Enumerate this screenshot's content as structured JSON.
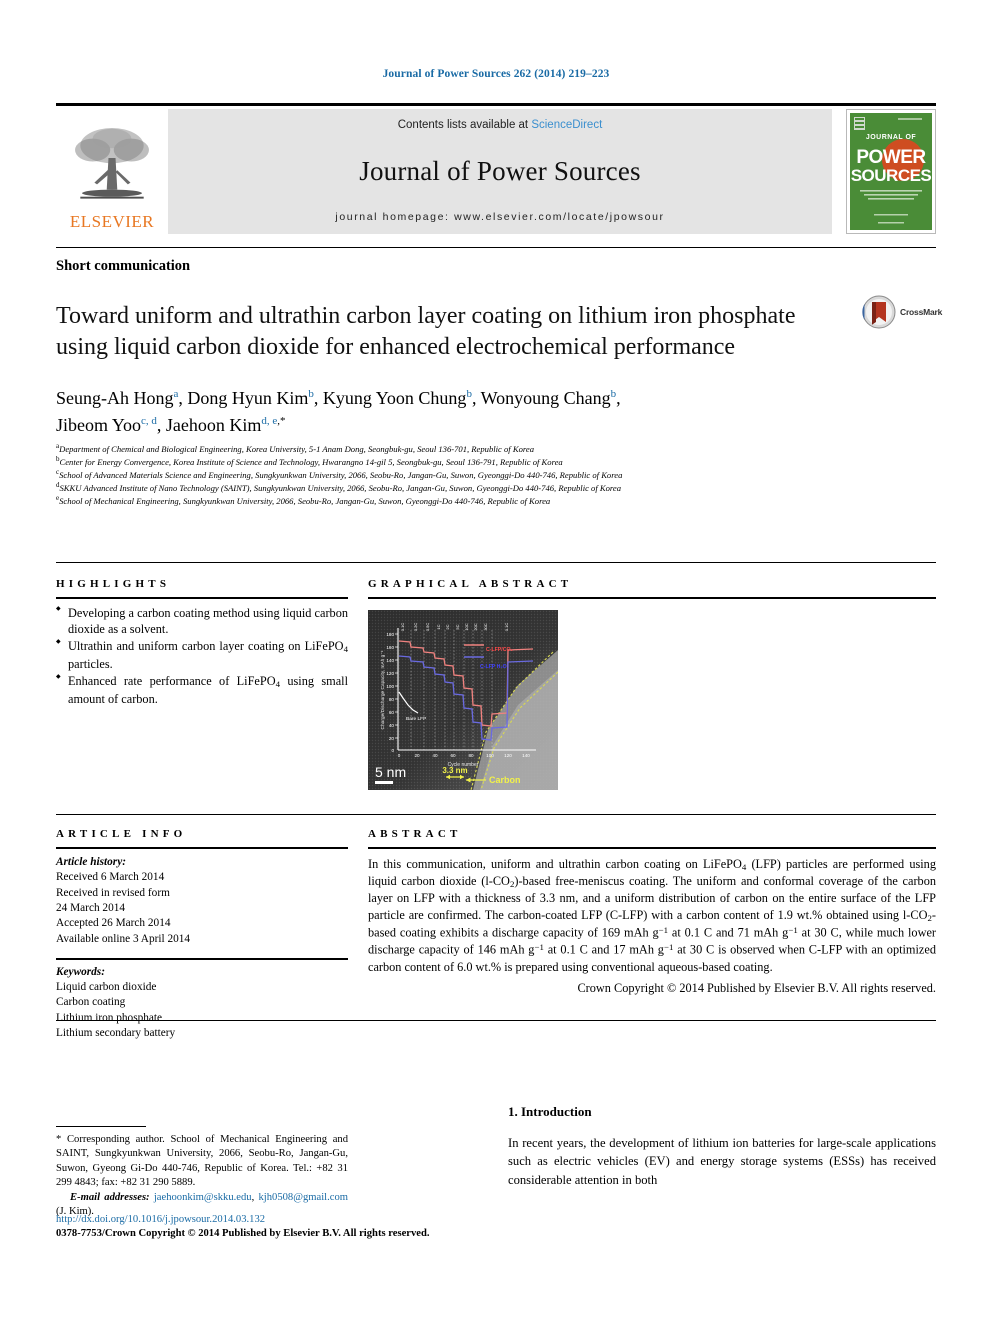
{
  "running_head": "Journal of Power Sources 262 (2014) 219–223",
  "masthead": {
    "publisher": "ELSEVIER",
    "contents_prefix": "Contents lists available at ",
    "sciencedirect": "ScienceDirect",
    "journal_name": "Journal of Power Sources",
    "homepage": "journal homepage: www.elsevier.com/locate/jpowsour",
    "cover_line1": "JOURNAL OF",
    "cover_line2": "POWER",
    "cover_line3": "SOURCES"
  },
  "article_type": "Short communication",
  "title": "Toward uniform and ultrathin carbon layer coating on lithium iron phosphate using liquid carbon dioxide for enhanced electrochemical performance",
  "crossmark_label": "CrossMark",
  "authors": [
    {
      "name": "Seung-Ah Hong",
      "sup": "a"
    },
    {
      "name": "Dong Hyun Kim",
      "sup": "b"
    },
    {
      "name": "Kyung Yoon Chung",
      "sup": "b"
    },
    {
      "name": "Wonyoung Chang",
      "sup": "b"
    },
    {
      "name": "Jibeom Yoo",
      "sup": "c, d"
    },
    {
      "name": "Jaehoon Kim",
      "sup": "d, e",
      "corresponding": true
    }
  ],
  "affiliations": [
    {
      "mark": "a",
      "text": "Department of Chemical and Biological Engineering, Korea University, 5-1 Anam Dong, Seongbuk-gu, Seoul 136-701, Republic of Korea"
    },
    {
      "mark": "b",
      "text": "Center for Energy Convergence, Korea Institute of Science and Technology, Hwarangno 14-gil 5, Seongbuk-gu, Seoul 136-791, Republic of Korea"
    },
    {
      "mark": "c",
      "text": "School of Advanced Materials Science and Engineering, Sungkyunkwan University, 2066, Seobu-Ro, Jangan-Gu, Suwon, Gyeonggi-Do 440-746, Republic of Korea"
    },
    {
      "mark": "d",
      "text": "SKKU Advanced Institute of Nano Technology (SAINT), Sungkyunkwan University, 2066, Seobu-Ro, Jangan-Gu, Suwon, Gyeonggi-Do 440-746, Republic of Korea"
    },
    {
      "mark": "e",
      "text": "School of Mechanical Engineering, Sungkyunkwan University, 2066, Seobu-Ro, Jangan-Gu, Suwon, Gyeonggi-Do 440-746, Republic of Korea"
    }
  ],
  "highlights": {
    "heading": "HIGHLIGHTS",
    "items": [
      "Developing a carbon coating method using liquid carbon dioxide as a solvent.",
      "Ultrathin and uniform carbon layer coating on LiFePO4 particles.",
      "Enhanced rate performance of LiFePO4 using small amount of carbon."
    ]
  },
  "graphical_abstract": {
    "heading": "GRAPHICAL ABSTRACT",
    "scale_bar": "5 nm",
    "thickness_label": "3.3 nm",
    "carbon_label": "Carbon"
  },
  "article_info": {
    "heading": "ARTICLE INFO",
    "history_label": "Article history:",
    "history": [
      "Received 6 March 2014",
      "Received in revised form",
      "24 March 2014",
      "Accepted 26 March 2014",
      "Available online 3 April 2014"
    ],
    "keywords_label": "Keywords:",
    "keywords": [
      "Liquid carbon dioxide",
      "Carbon coating",
      "Lithium iron phosphate",
      "Lithium secondary battery"
    ]
  },
  "abstract": {
    "heading": "ABSTRACT",
    "text_parts": [
      "In this communication, uniform and ultrathin carbon coating on LiFePO",
      "4",
      " (LFP) particles are performed using liquid carbon dioxide (l-CO",
      "2",
      ")-based free-meniscus coating. The uniform and conformal coverage of the carbon layer on LFP with a thickness of 3.3 nm, and a uniform distribution of carbon on the entire surface of the LFP particle are confirmed. The carbon-coated LFP (C-LFP) with a carbon content of 1.9 wt.% obtained using l-CO",
      "2",
      "-based coating exhibits a discharge capacity of 169 mAh g",
      "−1",
      " at 0.1 C and 71 mAh g",
      "−1",
      " at 30 C, while much lower discharge capacity of 146 mAh g",
      "−1",
      " at 0.1 C and 17 mAh g",
      "−1",
      " at 30 C is observed when C-LFP with an optimized carbon content of 6.0 wt.% is prepared using conventional aqueous-based coating."
    ],
    "copyright": "Crown Copyright © 2014 Published by Elsevier B.V. All rights reserved."
  },
  "footnote": {
    "corresponding": "* Corresponding author. School of Mechanical Engineering and SAINT, Sungkyunkwan University, 2066, Seobu-Ro, Jangan-Gu, Suwon, Gyeong Gi-Do 440-746, Republic of Korea. Tel.: +82 31 299 4843; fax: +82 31 290 5889.",
    "email_label": "E-mail addresses:",
    "email1": "jaehoonkim@skku.edu",
    "email2": "kjh0508@gmail.com",
    "email_suffix": "(J. Kim)."
  },
  "doi": "http://dx.doi.org/10.1016/j.jpowsour.2014.03.132",
  "issn_line": "0378-7753/Crown Copyright © 2014 Published by Elsevier B.V. All rights reserved.",
  "introduction": {
    "heading": "1. Introduction",
    "paragraph": "In recent years, the development of lithium ion batteries for large-scale applications such as electric vehicles (EV) and energy storage systems (ESSs) has received considerable attention in both"
  },
  "chart_data": {
    "type": "line",
    "title": "",
    "xlabel": "Cycle number",
    "ylabel": "Charge/Discharge Capacity, mAh g−1",
    "xlim": [
      0,
      150
    ],
    "ylim": [
      0,
      180
    ],
    "xticks": [
      0,
      20,
      40,
      60,
      80,
      100,
      120,
      140
    ],
    "yticks": [
      0,
      20,
      40,
      60,
      80,
      100,
      120,
      140,
      160,
      180
    ],
    "grid": true,
    "rate_labels": [
      "0.1C",
      "0.2C",
      "0.5C",
      "1C",
      "2C",
      "5C",
      "10C",
      "20C",
      "30C",
      "0.1C"
    ],
    "legend": [
      "C-LFP/CO2",
      "C-LFP H2O",
      "Bare LFP"
    ],
    "series": [
      {
        "name": "C-LFP/CO2",
        "color": "#e05a5a",
        "x": [
          1,
          12,
          25,
          38,
          50,
          62,
          75,
          88,
          100,
          125
        ],
        "values": [
          169,
          165,
          160,
          152,
          145,
          133,
          118,
          95,
          71,
          160
        ]
      },
      {
        "name": "C-LFP H2O",
        "color": "#4040cc",
        "x": [
          1,
          12,
          25,
          38,
          50,
          62,
          75,
          88,
          100,
          125
        ],
        "values": [
          146,
          142,
          136,
          128,
          118,
          103,
          82,
          50,
          17,
          138
        ]
      },
      {
        "name": "Bare LFP",
        "color": "#ffffff",
        "x": [
          1,
          10,
          20
        ],
        "values": [
          95,
          70,
          45
        ]
      }
    ]
  }
}
